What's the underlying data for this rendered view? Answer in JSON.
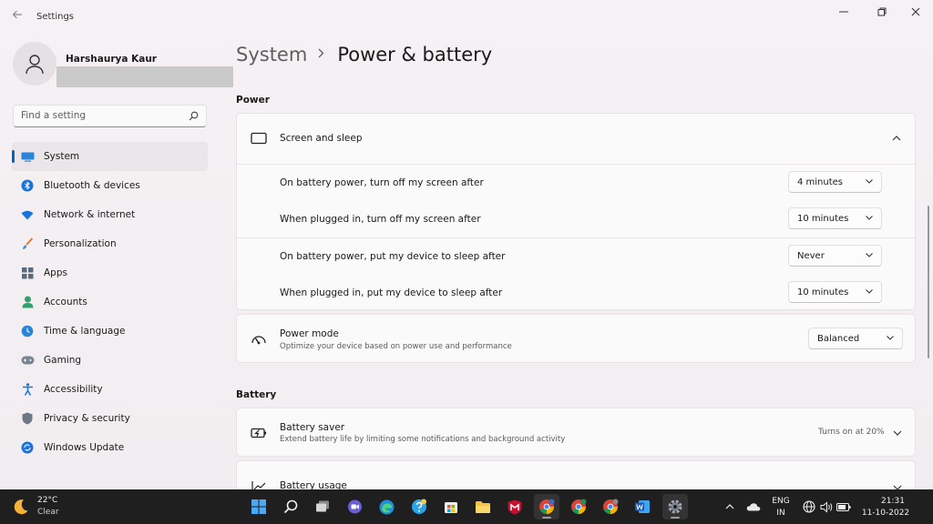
{
  "window": {
    "title": "Settings"
  },
  "profile": {
    "name": "Harshaurya Kaur"
  },
  "search": {
    "placeholder": "Find a setting"
  },
  "sidebar": {
    "items": [
      {
        "label": "System",
        "icon": "system-icon"
      },
      {
        "label": "Bluetooth & devices",
        "icon": "bluetooth-icon"
      },
      {
        "label": "Network & internet",
        "icon": "wifi-icon"
      },
      {
        "label": "Personalization",
        "icon": "brush-icon"
      },
      {
        "label": "Apps",
        "icon": "apps-icon"
      },
      {
        "label": "Accounts",
        "icon": "account-icon"
      },
      {
        "label": "Time & language",
        "icon": "globe-clock-icon"
      },
      {
        "label": "Gaming",
        "icon": "gamepad-icon"
      },
      {
        "label": "Accessibility",
        "icon": "accessibility-icon"
      },
      {
        "label": "Privacy & security",
        "icon": "shield-icon"
      },
      {
        "label": "Windows Update",
        "icon": "update-icon"
      }
    ]
  },
  "breadcrumb": {
    "parent": "System",
    "current": "Power & battery"
  },
  "power": {
    "section_title": "Power",
    "screen_sleep": {
      "title": "Screen and sleep",
      "rows": [
        {
          "label": "On battery power, turn off my screen after",
          "value": "4 minutes"
        },
        {
          "label": "When plugged in, turn off my screen after",
          "value": "10 minutes"
        },
        {
          "label": "On battery power, put my device to sleep after",
          "value": "Never"
        },
        {
          "label": "When plugged in, put my device to sleep after",
          "value": "10 minutes"
        }
      ]
    },
    "power_mode": {
      "title": "Power mode",
      "subtitle": "Optimize your device based on power use and performance",
      "value": "Balanced"
    }
  },
  "battery": {
    "section_title": "Battery",
    "saver": {
      "title": "Battery saver",
      "subtitle": "Extend battery life by limiting some notifications and background activity",
      "status": "Turns on at 20%"
    },
    "usage": {
      "title": "Battery usage"
    }
  },
  "taskbar": {
    "weather": {
      "temp": "22°C",
      "desc": "Clear"
    },
    "language": {
      "line1": "ENG",
      "line2": "IN"
    },
    "clock": {
      "time": "21:31",
      "date": "11-10-2022"
    }
  },
  "colors": {
    "accent": "#0067c0",
    "taskbar": "#1f1f1f",
    "background": "#f3eef1"
  }
}
